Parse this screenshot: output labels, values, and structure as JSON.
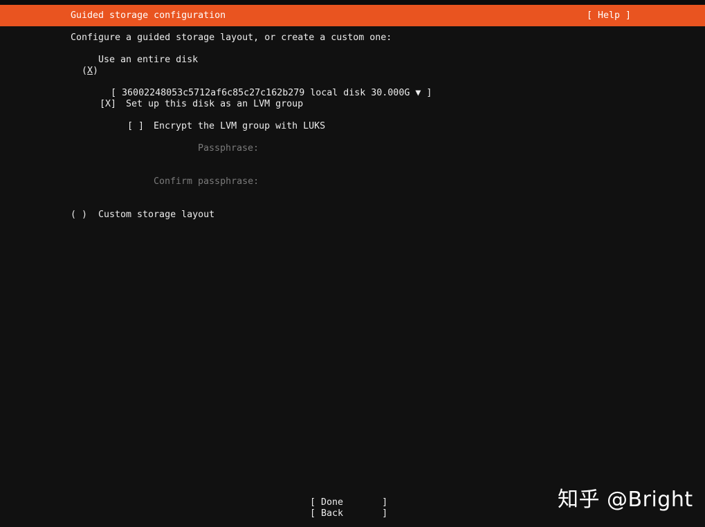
{
  "header": {
    "title": "Guided storage configuration",
    "help_label": "[ Help ]"
  },
  "intro": "Configure a guided storage layout, or create a custom one:",
  "options": {
    "entire_disk": {
      "radio_open": "(",
      "radio_mark": "X",
      "radio_close": ")",
      "label": "Use an entire disk"
    },
    "disk_select": {
      "open_bracket": "[",
      "value": "36002248053c5712af6c85c27c162b279 local disk 30.000G",
      "arrow": "▼",
      "close_bracket": "]"
    },
    "lvm": {
      "checkbox": "[X]",
      "label": "Set up this disk as an LVM group"
    },
    "encrypt": {
      "checkbox": "[ ]",
      "label": "Encrypt the LVM group with LUKS"
    },
    "passphrase": {
      "label": "Passphrase:",
      "value": ""
    },
    "confirm_passphrase": {
      "label": "Confirm passphrase:",
      "value": ""
    },
    "custom_layout": {
      "radio": "( )",
      "label": "Custom storage layout"
    }
  },
  "buttons": {
    "done": "[ Done       ]",
    "back": "[ Back       ]"
  },
  "watermark": "知乎 @Bright",
  "colors": {
    "accent": "#e95420",
    "background": "#111111",
    "text": "#ececec",
    "dim_text": "#7a7a7a"
  }
}
